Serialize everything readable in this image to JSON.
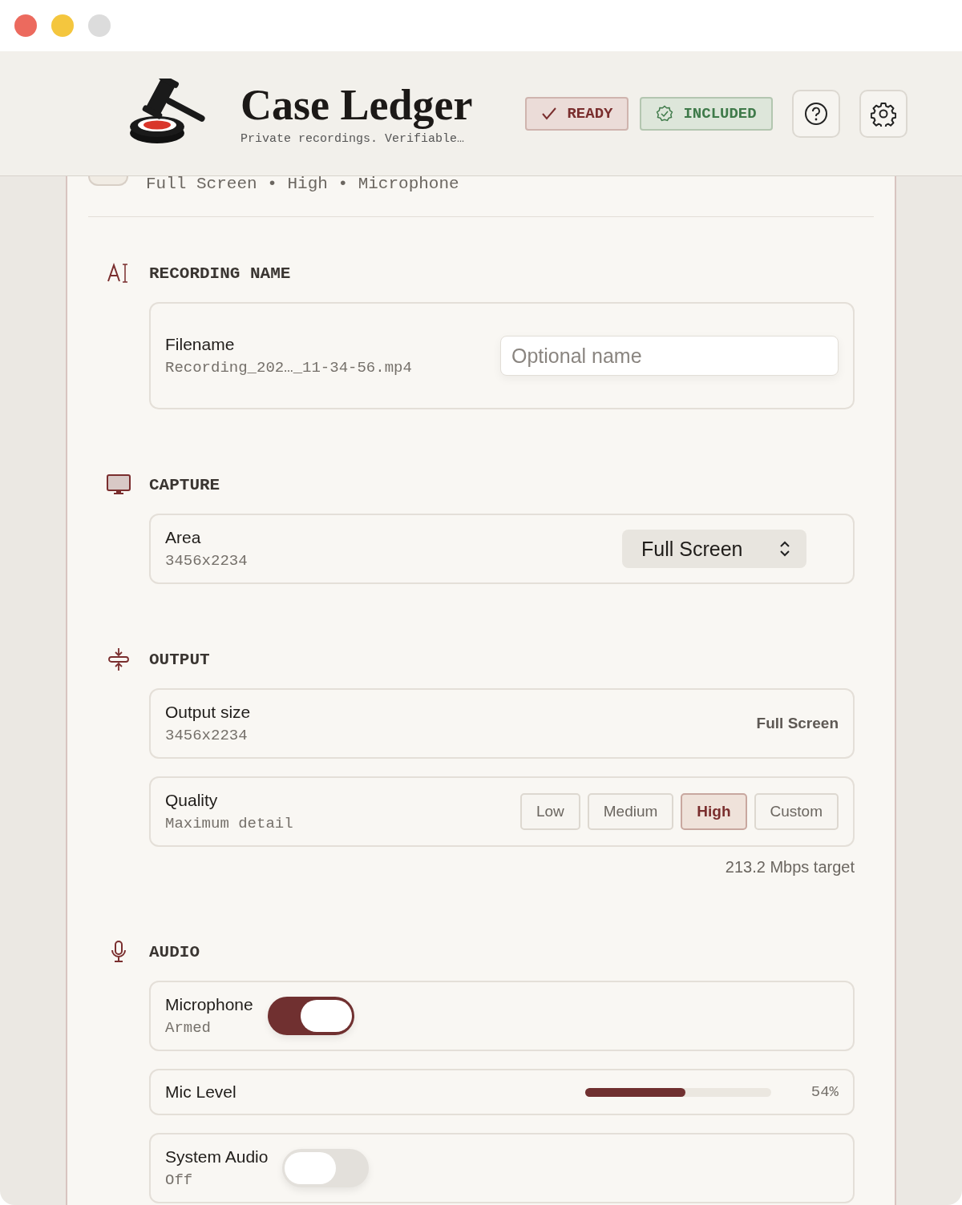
{
  "header": {
    "title": "Case Ledger",
    "tagline": "Private recordings. Verifiable…",
    "badges": [
      {
        "kind": "ready",
        "label": "READY"
      },
      {
        "kind": "included",
        "label": "INCLUDED"
      }
    ]
  },
  "summary": "Full Screen • High • Microphone",
  "sections": [
    {
      "kind": "name",
      "title": "RECORDING NAME",
      "rows": [
        {
          "kind": "field",
          "label": "Filename",
          "sub": "Recording_202…_11-34-56.mp4",
          "placeholder": "Optional name"
        }
      ]
    },
    {
      "kind": "capture",
      "title": "CAPTURE",
      "rows": [
        {
          "kind": "select",
          "label": "Area",
          "sub": "3456x2234",
          "value": "Full Screen"
        }
      ]
    },
    {
      "kind": "output",
      "title": "OUTPUT",
      "rows": [
        {
          "kind": "value",
          "label": "Output size",
          "sub": "3456x2234",
          "value": "Full Screen"
        },
        {
          "kind": "segmented",
          "label": "Quality",
          "sub": "Maximum detail",
          "options": [
            {
              "label": "Low",
              "selected": false
            },
            {
              "label": "Medium",
              "selected": false
            },
            {
              "label": "High",
              "selected": true
            },
            {
              "label": "Custom",
              "selected": false
            }
          ]
        }
      ],
      "note": "213.2 Mbps target"
    },
    {
      "kind": "audio",
      "title": "AUDIO",
      "rows": [
        {
          "kind": "toggle",
          "label": "Microphone",
          "sub": "Armed",
          "on": true
        },
        {
          "kind": "meter",
          "label": "Mic Level",
          "level": 0.54,
          "reading": "54%"
        },
        {
          "kind": "toggle",
          "label": "System Audio",
          "sub": "Off",
          "on": false
        }
      ]
    }
  ]
}
